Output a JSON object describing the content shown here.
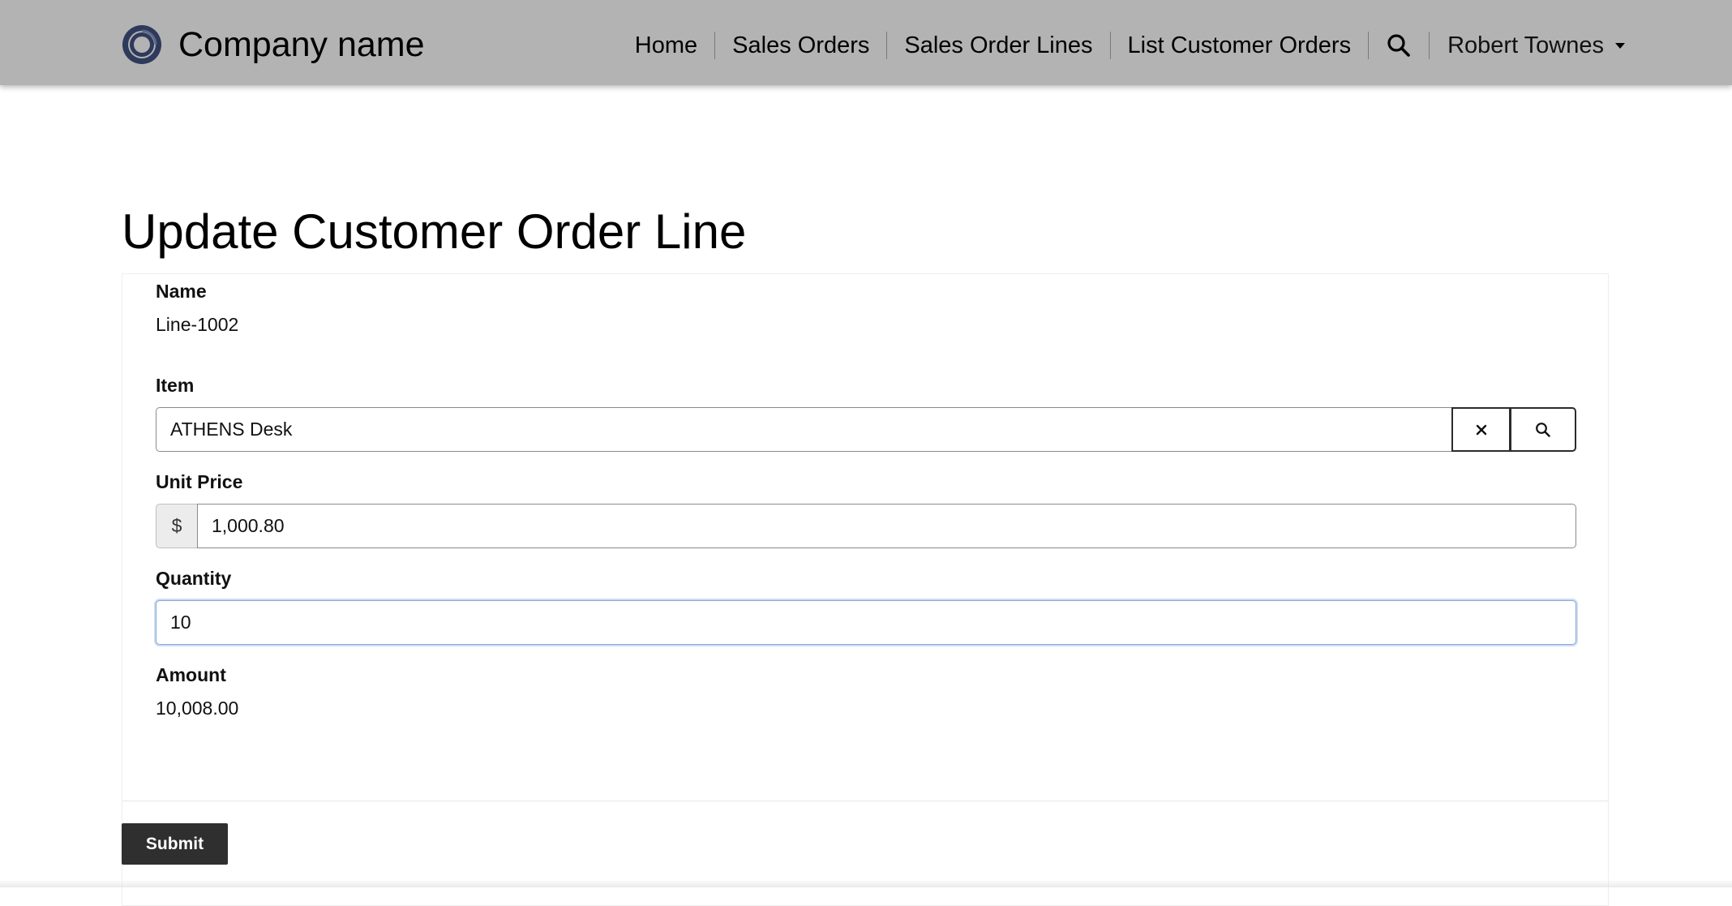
{
  "brand": {
    "name": "Company name",
    "logo_icon": "ring-logo-icon",
    "logo_color": "#2e3a5c"
  },
  "nav": {
    "items": [
      "Home",
      "Sales Orders",
      "Sales Order Lines",
      "List Customer Orders"
    ],
    "search_icon": "search-icon",
    "user_name": "Robert Townes",
    "user_menu_icon": "caret-down-icon"
  },
  "page": {
    "title": "Update Customer Order Line"
  },
  "form": {
    "name": {
      "label": "Name",
      "value": "Line-1002"
    },
    "item": {
      "label": "Item",
      "value": "ATHENS Desk",
      "clear_icon": "close-icon",
      "search_icon": "search-icon"
    },
    "unit_price": {
      "label": "Unit Price",
      "currency_symbol": "$",
      "value": "1,000.80"
    },
    "quantity": {
      "label": "Quantity",
      "value": "10"
    },
    "amount": {
      "label": "Amount",
      "value": "10,008.00"
    }
  },
  "actions": {
    "submit_label": "Submit"
  },
  "colors": {
    "navbar_bg": "#b3b3b3",
    "submit_bg": "#2f2f2f",
    "focus_border": "#86a9d8"
  }
}
